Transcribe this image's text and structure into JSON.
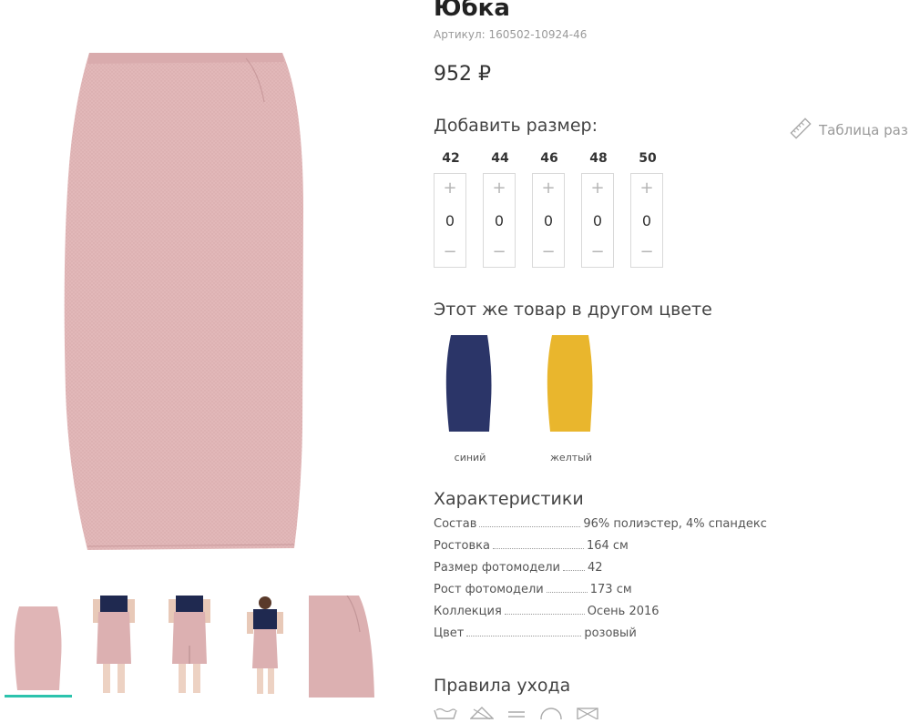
{
  "product": {
    "title": "Юбка",
    "sku": "Артикул: 160502-10924-46",
    "price": "952 ₽"
  },
  "sizes": {
    "title": "Добавить размер:",
    "table_link": "Таблица раз",
    "items": [
      {
        "label": "42",
        "qty": "0"
      },
      {
        "label": "44",
        "qty": "0"
      },
      {
        "label": "46",
        "qty": "0"
      },
      {
        "label": "48",
        "qty": "0"
      },
      {
        "label": "50",
        "qty": "0"
      }
    ],
    "plus": "+",
    "minus": "−"
  },
  "other_colors": {
    "title": "Этот же товар в другом цвете",
    "items": [
      {
        "label": "синий",
        "color": "#2b3568"
      },
      {
        "label": "желтый",
        "color": "#e9b62d"
      }
    ]
  },
  "characteristics": {
    "title": "Характеристики",
    "rows": [
      {
        "key": "Состав",
        "value": "96% полиэстер, 4% спандекс"
      },
      {
        "key": "Ростовка",
        "value": "164 см"
      },
      {
        "key": "Размер фотомодели",
        "value": "42"
      },
      {
        "key": "Рост фотомодели",
        "value": "173 см"
      },
      {
        "key": "Коллекция",
        "value": "Осень 2016"
      },
      {
        "key": "Цвет",
        "value": "розовый"
      }
    ]
  },
  "care": {
    "title": "Правила ухода"
  },
  "colors": {
    "skirt": "#e2b8b9",
    "accent": "#2cc3ad"
  }
}
